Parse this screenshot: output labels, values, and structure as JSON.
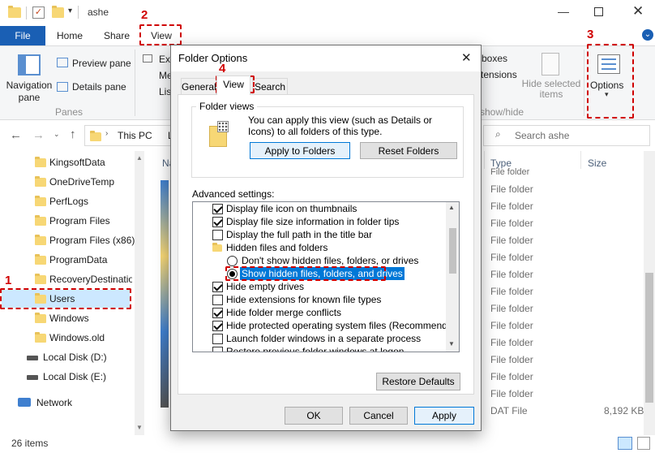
{
  "explorer": {
    "window_title": "ashe",
    "tabs": {
      "file": "File",
      "home": "Home",
      "share": "Share",
      "view": "View"
    },
    "ribbon": {
      "navigation_pane": "Navigation pane",
      "preview_pane": "Preview pane",
      "details_pane": "Details pane",
      "panes_group": "Panes",
      "extra_large": "Ext",
      "medium": "Me",
      "list": "Lis",
      "boxes": "boxes",
      "extensions": "tensions",
      "show_hide": "show/hide",
      "hide_selected": "Hide selected items",
      "options": "Options"
    },
    "address": {
      "path_part": "This PC",
      "path_part2": "L",
      "search_placeholder": "Search ashe"
    },
    "nav_items": [
      "KingsoftData",
      "OneDriveTemp",
      "PerfLogs",
      "Program Files",
      "Program Files (x86)",
      "ProgramData",
      "RecoveryDestinatio",
      "Users",
      "Windows",
      "Windows.old",
      "Local Disk (D:)",
      "Local Disk (E:)",
      "Network"
    ],
    "columns": {
      "name": "Na",
      "type": "Type",
      "size": "Size"
    },
    "row_type": "File folder",
    "last_row": {
      "type": "DAT File",
      "size": "8,192 KB"
    },
    "status": "26 items"
  },
  "annotations": {
    "n1": "1",
    "n2": "2",
    "n3": "3",
    "n4": "4"
  },
  "dialog": {
    "title": "Folder Options",
    "tabs": {
      "general": "General",
      "view": "View",
      "search": "Search"
    },
    "folder_views": {
      "legend": "Folder views",
      "description": "You can apply this view (such as Details or Icons) to all folders of this type.",
      "apply_button": "Apply to Folders",
      "reset_button": "Reset Folders"
    },
    "advanced_label": "Advanced settings:",
    "advanced_items": [
      {
        "label": "Display file icon on thumbnails",
        "kind": "check",
        "checked": true
      },
      {
        "label": "Display file size information in folder tips",
        "kind": "check",
        "checked": true
      },
      {
        "label": "Display the full path in the title bar",
        "kind": "check",
        "checked": false
      },
      {
        "label": "Hidden files and folders",
        "kind": "folder",
        "checked": false
      },
      {
        "label": "Don't show hidden files, folders, or drives",
        "kind": "radio",
        "checked": false
      },
      {
        "label": "Show hidden files, folders, and drives",
        "kind": "radio",
        "checked": true
      },
      {
        "label": "Hide empty drives",
        "kind": "check",
        "checked": true
      },
      {
        "label": "Hide extensions for known file types",
        "kind": "check",
        "checked": false
      },
      {
        "label": "Hide folder merge conflicts",
        "kind": "check",
        "checked": true
      },
      {
        "label": "Hide protected operating system files (Recommended)",
        "kind": "check",
        "checked": true
      },
      {
        "label": "Launch folder windows in a separate process",
        "kind": "check",
        "checked": false
      },
      {
        "label": "Restore previous folder windows at logon",
        "kind": "check",
        "checked": false
      }
    ],
    "restore_defaults": "Restore Defaults",
    "ok": "OK",
    "cancel": "Cancel",
    "apply": "Apply"
  }
}
